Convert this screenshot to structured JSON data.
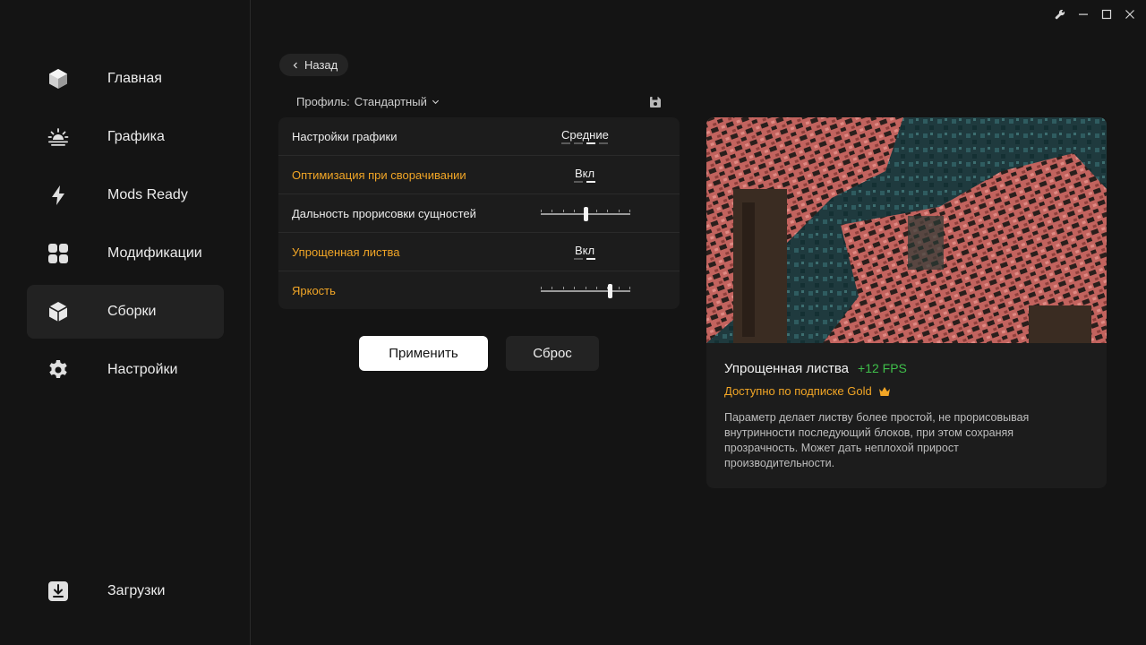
{
  "sidebar": {
    "items": [
      {
        "label": "Главная",
        "icon": "cube-icon"
      },
      {
        "label": "Графика",
        "icon": "sunrise-icon"
      },
      {
        "label": "Mods Ready",
        "icon": "lightning-icon"
      },
      {
        "label": "Модификации",
        "icon": "grid-icon"
      },
      {
        "label": "Сборки",
        "icon": "box-icon",
        "active": true
      },
      {
        "label": "Настройки",
        "icon": "gear-icon"
      }
    ],
    "downloads": {
      "label": "Загрузки",
      "icon": "download-icon"
    }
  },
  "main": {
    "back_label": "Назад",
    "profile_label": "Профиль:",
    "profile_value": "Стандартный",
    "settings": [
      {
        "label": "Настройки графики",
        "gold": false,
        "type": "segmented",
        "value": "Средние",
        "selected": 3,
        "options_count": 4
      },
      {
        "label": "Оптимизация при сворачивании",
        "gold": true,
        "type": "segmented",
        "value": "Вкл",
        "selected": 2,
        "options_count": 2
      },
      {
        "label": "Дальность прорисовки сущностей",
        "gold": false,
        "type": "slider",
        "level": 0.5
      },
      {
        "label": "Упрощенная листва",
        "gold": true,
        "type": "segmented",
        "value": "Вкл",
        "selected": 2,
        "options_count": 2
      },
      {
        "label": "Яркость",
        "gold": true,
        "type": "slider",
        "level": 0.77
      }
    ],
    "apply_label": "Применить",
    "reset_label": "Сброс"
  },
  "preview": {
    "title": "Упрощенная листва",
    "fps": "+12 FPS",
    "subscription": "Доступно по подписке Gold",
    "description": "Параметр делает листву более простой, не прорисовывая внутринности последующий блоков, при этом сохраняя прозрачность. Может дать неплохой прирост производительности."
  },
  "colors": {
    "accent_gold": "#f2a626",
    "fps_green": "#3fbf4a",
    "background": "#141414",
    "panel": "#1c1c1c"
  }
}
